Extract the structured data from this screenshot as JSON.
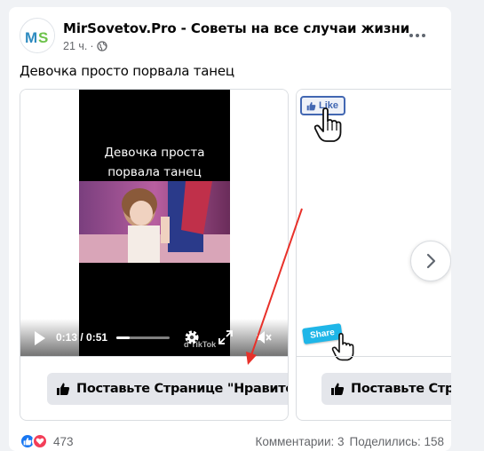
{
  "post": {
    "page_name": "MirSovetov.Pro - Советы на все случаи жизни",
    "timestamp": "21 ч.",
    "privacy_dot": "·",
    "text": "Девочка просто порвала танец"
  },
  "video": {
    "caption_line1": "Девочка проста",
    "caption_line2": "порвала танец",
    "time": "0:13 / 0:51",
    "progress": 0.255,
    "watermark": "d TikTok"
  },
  "cards": [
    {
      "button_label": "Поставьте Странице \"Нравится\""
    },
    {
      "button_label": "Поставьте Странице \"Нравится\""
    }
  ],
  "card2": {
    "like_badge": "Like",
    "share_badge": "Share"
  },
  "footer": {
    "reactions_count": "473",
    "comments": "Комментарии: 3",
    "shares": "Поделились: 158"
  },
  "colors": {
    "facebook_blue": "#1877f2",
    "button_gray": "#e4e6eb",
    "arrow_red": "#e8312a"
  },
  "icons": [
    "site-logo-icon",
    "globe-icon",
    "more-options-icon",
    "play-icon",
    "gear-icon",
    "fullscreen-icon",
    "mute-icon",
    "thumbs-up-icon",
    "chevron-right-icon",
    "hand-cursor-icon",
    "like-reaction-icon",
    "love-reaction-icon"
  ]
}
